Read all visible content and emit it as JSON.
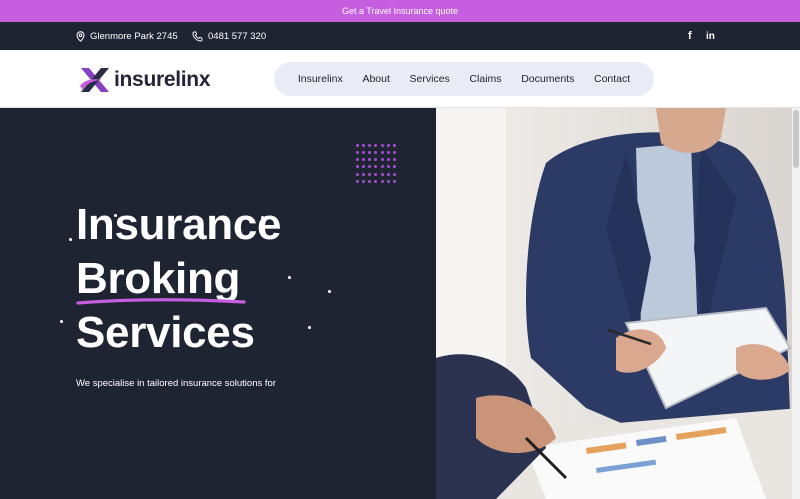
{
  "promo": {
    "text": "Get a Travel Insurance quote"
  },
  "topbar": {
    "location": "Glenmore Park 2745",
    "phone": "0481 577 320",
    "social": [
      "f",
      "in"
    ]
  },
  "brand": {
    "name": "insurelinx",
    "accent": "#c65ee0",
    "dark": "#1f2433"
  },
  "nav": {
    "items": [
      "Insurelinx",
      "About",
      "Services",
      "Claims",
      "Documents",
      "Contact"
    ]
  },
  "hero": {
    "line1": "Insurance",
    "line2": "Broking",
    "line3": "Services",
    "subtext": "We specialise in tailored insurance solutions for"
  },
  "icons": [
    "location-pin-icon",
    "phone-icon",
    "facebook-icon",
    "linkedin-icon",
    "logo-x-icon"
  ]
}
